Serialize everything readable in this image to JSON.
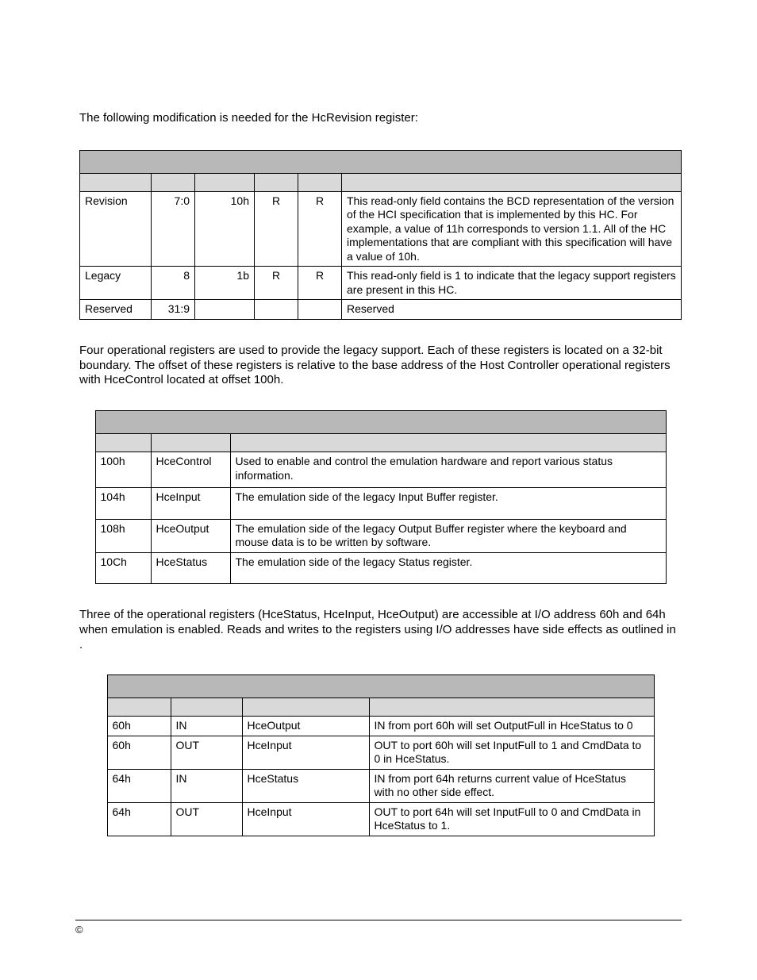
{
  "intro": "The following modification is needed for the HcRevision register:",
  "table1": {
    "rows": [
      {
        "field": "Revision",
        "bits": "7:0",
        "default": "10h",
        "hcd": "R",
        "hc": "R",
        "desc": "This read-only field contains the BCD representation of the version of the HCI specification that is implemented by this HC. For example, a value of 11h corresponds to version 1.1. All of the HC implementations that are compliant with this specification will have a value of 10h."
      },
      {
        "field": "Legacy",
        "bits": "8",
        "default": "1b",
        "hcd": "R",
        "hc": "R",
        "desc": "This read-only field is 1 to indicate that the legacy support registers are present in this HC."
      },
      {
        "field": "Reserved",
        "bits": "31:9",
        "default": "",
        "hcd": "",
        "hc": "",
        "desc": "Reserved"
      }
    ]
  },
  "mid1": "Four operational registers are used to provide the legacy support. Each of these registers is located on a 32-bit boundary. The offset of these registers is relative to the base address of the Host Controller operational registers with HceControl located at offset 100h.",
  "table2": {
    "rows": [
      {
        "offset": "100h",
        "reg": "HceControl",
        "desc": "Used to enable and control the emulation hardware and report various status information."
      },
      {
        "offset": "104h",
        "reg": "HceInput",
        "desc": "The emulation side of the legacy Input Buffer register."
      },
      {
        "offset": "108h",
        "reg": "HceOutput",
        "desc": "The emulation side of the legacy Output Buffer register where the keyboard and mouse data is to be written by software."
      },
      {
        "offset": "10Ch",
        "reg": "HceStatus",
        "desc": "The emulation side of the legacy Status register."
      }
    ]
  },
  "mid2a": "Three of the operational registers (HceStatus, HceInput, HceOutput) are accessible at I/O address 60h and 64h when emulation is enabled. Reads and writes to the registers using I/O addresses have side effects as outlined in ",
  "mid2b": ".",
  "table3": {
    "rows": [
      {
        "addr": "60h",
        "cyc": "IN",
        "reg": "HceOutput",
        "effect": "IN from port 60h will set OutputFull in HceStatus to 0"
      },
      {
        "addr": "60h",
        "cyc": "OUT",
        "reg": "HceInput",
        "effect": "OUT to port 60h will set InputFull to 1 and CmdData to 0 in HceStatus."
      },
      {
        "addr": "64h",
        "cyc": "IN",
        "reg": "HceStatus",
        "effect": "IN from port 64h returns current value of HceStatus with no other side effect."
      },
      {
        "addr": "64h",
        "cyc": "OUT",
        "reg": "HceInput",
        "effect": "OUT to port 64h will set InputFull to 0 and CmdData in HceStatus to 1."
      }
    ]
  },
  "footer": "©"
}
